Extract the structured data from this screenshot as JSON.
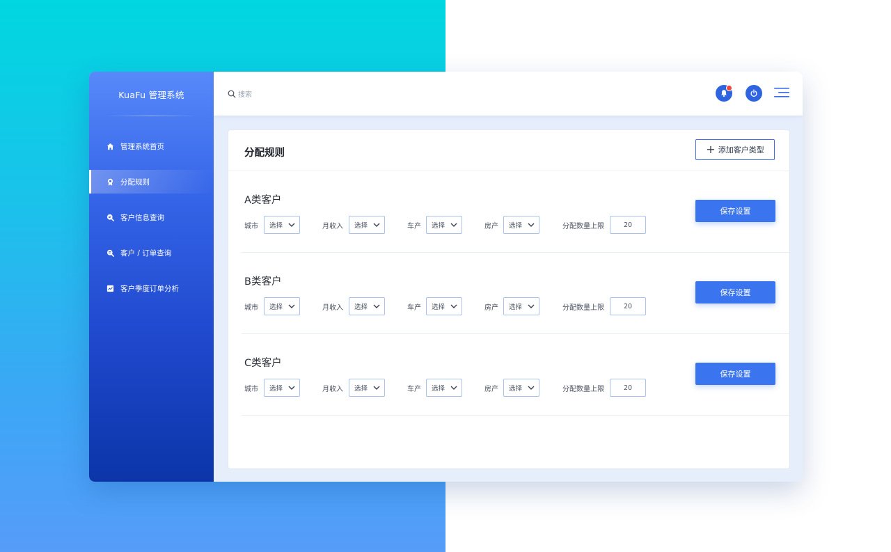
{
  "app": {
    "brand": "KuaFu 管理系统"
  },
  "sidebar": {
    "items": [
      {
        "label": "管理系统首页",
        "icon": "home-icon"
      },
      {
        "label": "分配规则",
        "icon": "badge-icon",
        "active": true
      },
      {
        "label": "客户信息查询",
        "icon": "search-doc-icon"
      },
      {
        "label": "客户 / 订单查询",
        "icon": "search-doc-icon"
      },
      {
        "label": "客户季度订单分析",
        "icon": "chart-icon"
      }
    ]
  },
  "topbar": {
    "search_placeholder": "搜索",
    "icons": [
      "bell-icon",
      "power-icon",
      "menu-icon"
    ],
    "notification_dot_color": "#f2453b"
  },
  "panel": {
    "title": "分配规则",
    "add_button": "添加客户类型",
    "groups": [
      {
        "title": "A类客户",
        "fields": {
          "city": "城市",
          "income": "月收入",
          "car": "车产",
          "house": "房产",
          "limit": "分配数量上限"
        },
        "select_value": "选择",
        "limit_value": "20",
        "save": "保存设置"
      },
      {
        "title": "B类客户",
        "fields": {
          "city": "城市",
          "income": "月收入",
          "car": "车产",
          "house": "房产",
          "limit": "分配数量上限"
        },
        "select_value": "选择",
        "limit_value": "20",
        "save": "保存设置"
      },
      {
        "title": "C类客户",
        "fields": {
          "city": "城市",
          "income": "月收入",
          "car": "车产",
          "house": "房产",
          "limit": "分配数量上限"
        },
        "select_value": "选择",
        "limit_value": "20",
        "save": "保存设置"
      }
    ]
  },
  "colors": {
    "accent": "#3a74ef",
    "sidebar_top": "#5889fa",
    "sidebar_bottom": "#0b35a8"
  }
}
